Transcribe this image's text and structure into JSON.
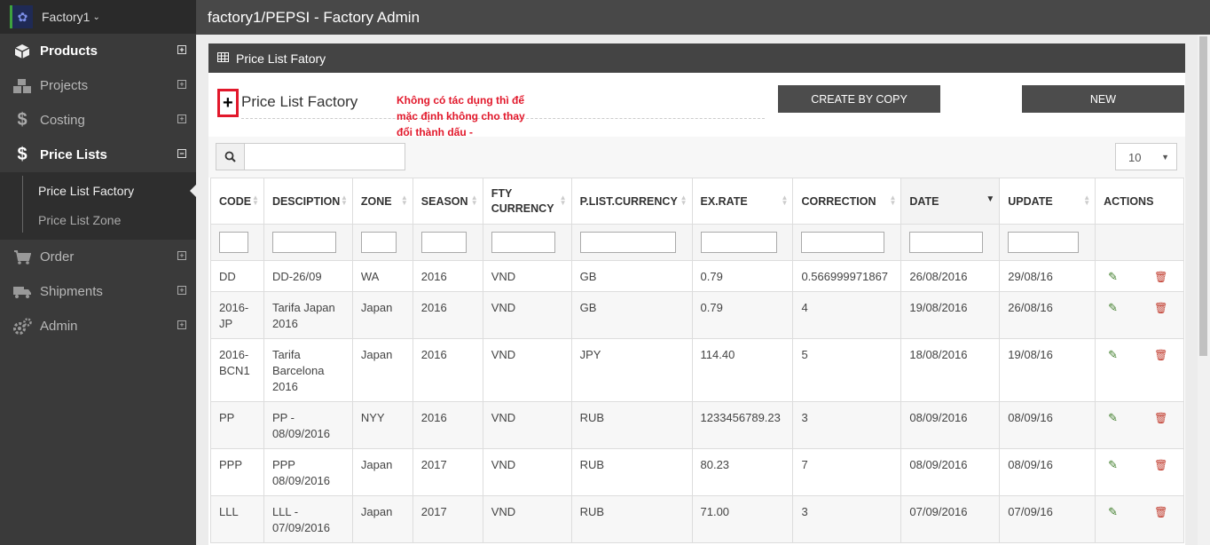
{
  "brand": {
    "name": "Factory1",
    "chevron": "chevron-down-icon"
  },
  "header": {
    "title": "factory1/PEPSI - Factory Admin"
  },
  "sidebar": {
    "items": [
      {
        "label": "Products",
        "icon": "cube-icon",
        "toggle": "⊞"
      },
      {
        "label": "Projects",
        "icon": "cubes-icon",
        "toggle": "⊞"
      },
      {
        "label": "Costing",
        "icon": "dollar-icon",
        "toggle": "⊞"
      },
      {
        "label": "Price Lists",
        "icon": "dollar-icon",
        "toggle": "⊟"
      },
      {
        "label": "Order",
        "icon": "cart-icon",
        "toggle": "⊞"
      },
      {
        "label": "Shipments",
        "icon": "truck-icon",
        "toggle": "⊞"
      },
      {
        "label": "Admin",
        "icon": "gears-icon",
        "toggle": "⊞"
      }
    ],
    "submenu": [
      "Price List Factory",
      "Price List Zone"
    ]
  },
  "panel": {
    "heading": "Price List Fatory",
    "subtitle": "Price List Factory",
    "plus_symbol": "+",
    "annotation": "Không có tác dụng thì để mặc định không cho thay đổi thành dấu -",
    "create_by_copy": "CREATE BY COPY",
    "new": "NEW",
    "page_size": "10"
  },
  "table": {
    "columns": [
      "CODE",
      "DESCIPTION",
      "ZONE",
      "SEASON",
      "FTY CURRENCY",
      "P.LIST.CURRENCY",
      "EX.RATE",
      "CORRECTION",
      "DATE",
      "UPDATE",
      "ACTIONS"
    ],
    "sorted_column": "DATE",
    "rows": [
      [
        "DD",
        "DD-26/09",
        "WA",
        "2016",
        "VND",
        "GB",
        "0.79",
        "0.566999971867",
        "26/08/2016",
        "29/08/16"
      ],
      [
        "2016-JP",
        "Tarifa Japan 2016",
        "Japan",
        "2016",
        "VND",
        "GB",
        "0.79",
        "4",
        "19/08/2016",
        "26/08/16"
      ],
      [
        "2016-BCN1",
        "Tarifa Barcelona 2016",
        "Japan",
        "2016",
        "VND",
        "JPY",
        "114.40",
        "5",
        "18/08/2016",
        "19/08/16"
      ],
      [
        "PP",
        "PP - 08/09/2016",
        "NYY",
        "2016",
        "VND",
        "RUB",
        "1233456789.23",
        "3",
        "08/09/2016",
        "08/09/16"
      ],
      [
        "PPP",
        "PPP 08/09/2016",
        "Japan",
        "2017",
        "VND",
        "RUB",
        "80.23",
        "7",
        "08/09/2016",
        "08/09/16"
      ],
      [
        "LLL",
        "LLL - 07/09/2016",
        "Japan",
        "2017",
        "VND",
        "RUB",
        "71.00",
        "3",
        "07/09/2016",
        "07/09/16"
      ]
    ]
  },
  "colors": {
    "accent_red": "#e2182b",
    "sidebar_bg": "#3a3a3a",
    "header_bg": "#484848",
    "edit_green": "#3a7a24",
    "delete_red": "#c0392b"
  }
}
